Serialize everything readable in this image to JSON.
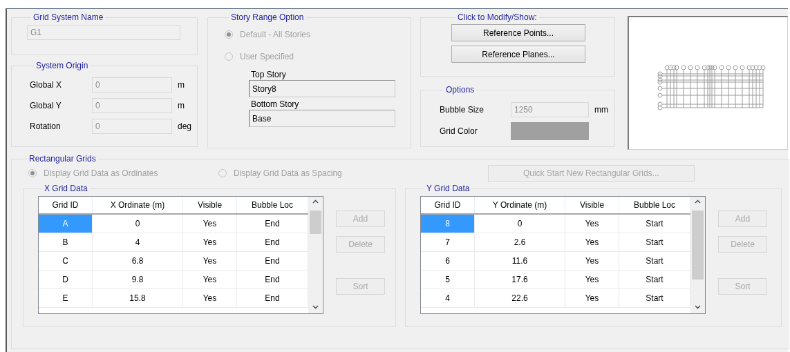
{
  "grid_system_name": {
    "title": "Grid System Name",
    "value": "G1",
    "disabled": true
  },
  "system_origin": {
    "title": "System Origin",
    "fields": [
      {
        "label": "Global  X",
        "value": "0",
        "unit": "m",
        "disabled": true
      },
      {
        "label": "Global  Y",
        "value": "0",
        "unit": "m",
        "disabled": true
      },
      {
        "label": "Rotation",
        "value": "0",
        "unit": "deg",
        "disabled": true
      }
    ]
  },
  "story_range_option": {
    "title": "Story Range Option",
    "options": [
      {
        "label": "Default - All Stories",
        "selected": true,
        "disabled": true
      },
      {
        "label": "User Specified",
        "selected": false,
        "disabled": true
      }
    ],
    "top_story": {
      "label": "Top Story",
      "value": "Story8"
    },
    "bottom_story": {
      "label": "Bottom Story",
      "value": "Base"
    }
  },
  "click_to_modify": {
    "title": "Click to Modify/Show:",
    "buttons": [
      {
        "label": "Reference Points...",
        "disabled": false
      },
      {
        "label": "Reference Planes...",
        "disabled": false
      }
    ]
  },
  "options": {
    "title": "Options",
    "bubble_size": {
      "label": "Bubble Size",
      "value": "1250",
      "unit": "mm",
      "disabled": true
    },
    "grid_color": {
      "label": "Grid Color",
      "color": "#a0a0a0"
    }
  },
  "rectangular_grids": {
    "title": "Rectangular Grids",
    "display_options": [
      {
        "label": "Display Grid Data as Ordinates",
        "selected": true,
        "disabled": true
      },
      {
        "label": "Display Grid Data as Spacing",
        "selected": false,
        "disabled": true
      }
    ],
    "quick_start_button": {
      "label": "Quick Start New Rectangular Grids...",
      "disabled": true
    },
    "tables": [
      {
        "title": "X Grid Data",
        "columns": [
          "Grid ID",
          "X Ordinate (m)",
          "Visible",
          "Bubble Loc"
        ],
        "rows": [
          {
            "cells": [
              "A",
              "0",
              "Yes",
              "End"
            ],
            "selected": true
          },
          {
            "cells": [
              "B",
              "4",
              "Yes",
              "End"
            ],
            "selected": false
          },
          {
            "cells": [
              "C",
              "6.8",
              "Yes",
              "End"
            ],
            "selected": false
          },
          {
            "cells": [
              "D",
              "9.8",
              "Yes",
              "End"
            ],
            "selected": false
          },
          {
            "cells": [
              "E",
              "15.8",
              "Yes",
              "End"
            ],
            "selected": false
          }
        ],
        "buttons": [
          {
            "label": "Add",
            "disabled": true
          },
          {
            "label": "Delete",
            "disabled": true
          },
          {
            "label": "Sort",
            "disabled": true
          }
        ]
      },
      {
        "title": "Y Grid Data",
        "columns": [
          "Grid ID",
          "Y Ordinate (m)",
          "Visible",
          "Bubble Loc"
        ],
        "rows": [
          {
            "cells": [
              "8",
              "0",
              "Yes",
              "Start"
            ],
            "selected": true
          },
          {
            "cells": [
              "7",
              "2.6",
              "Yes",
              "Start"
            ],
            "selected": false
          },
          {
            "cells": [
              "6",
              "11.6",
              "Yes",
              "Start"
            ],
            "selected": false
          },
          {
            "cells": [
              "5",
              "17.6",
              "Yes",
              "Start"
            ],
            "selected": false
          },
          {
            "cells": [
              "4",
              "22.6",
              "Yes",
              "Start"
            ],
            "selected": false
          }
        ],
        "buttons": [
          {
            "label": "Add",
            "disabled": true
          },
          {
            "label": "Delete",
            "disabled": true
          },
          {
            "label": "Sort",
            "disabled": true
          }
        ]
      }
    ]
  }
}
